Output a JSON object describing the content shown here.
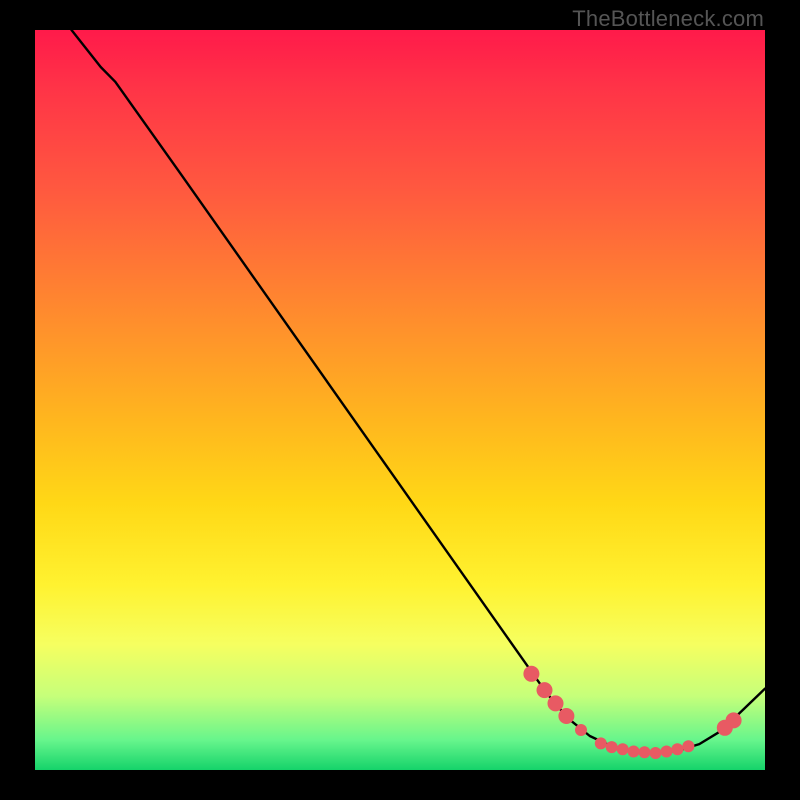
{
  "watermark": "TheBottleneck.com",
  "chart_data": {
    "type": "line",
    "title": "",
    "xlabel": "",
    "ylabel": "",
    "xlim": [
      0,
      100
    ],
    "ylim": [
      0,
      100
    ],
    "grid": false,
    "series": [
      {
        "name": "curve",
        "x": [
          5,
          9,
          11,
          20,
          30,
          40,
          50,
          60,
          67,
          70,
          73,
          76,
          79,
          82,
          85,
          88,
          91,
          94,
          100
        ],
        "y": [
          100,
          95,
          93,
          80.5,
          66.5,
          52.5,
          38.5,
          24.5,
          14.7,
          10.5,
          7.0,
          4.6,
          3.2,
          2.5,
          2.3,
          2.6,
          3.5,
          5.3,
          11.0
        ]
      }
    ],
    "markers": [
      {
        "x": 68.0,
        "y": 13.0,
        "size": "lg"
      },
      {
        "x": 69.8,
        "y": 10.8,
        "size": "lg"
      },
      {
        "x": 71.3,
        "y": 9.0,
        "size": "lg"
      },
      {
        "x": 72.8,
        "y": 7.3,
        "size": "lg"
      },
      {
        "x": 74.8,
        "y": 5.4,
        "size": "sm"
      },
      {
        "x": 77.5,
        "y": 3.6,
        "size": "sm"
      },
      {
        "x": 79.0,
        "y": 3.1,
        "size": "sm"
      },
      {
        "x": 80.5,
        "y": 2.8,
        "size": "sm"
      },
      {
        "x": 82.0,
        "y": 2.5,
        "size": "sm"
      },
      {
        "x": 83.5,
        "y": 2.4,
        "size": "sm"
      },
      {
        "x": 85.0,
        "y": 2.3,
        "size": "sm"
      },
      {
        "x": 86.5,
        "y": 2.5,
        "size": "sm"
      },
      {
        "x": 88.0,
        "y": 2.8,
        "size": "sm"
      },
      {
        "x": 89.5,
        "y": 3.2,
        "size": "sm"
      },
      {
        "x": 94.5,
        "y": 5.7,
        "size": "lg"
      },
      {
        "x": 95.7,
        "y": 6.7,
        "size": "lg"
      }
    ],
    "background_gradient": {
      "top": "#ff1a4a",
      "bottom": "#15d36a"
    }
  }
}
